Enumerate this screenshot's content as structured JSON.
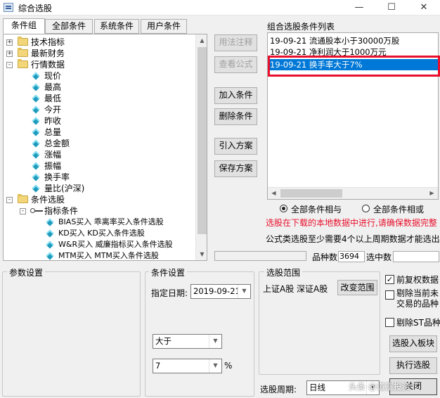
{
  "window": {
    "title": "综合选股",
    "minimize": "—",
    "maximize": "☐",
    "close": "✕"
  },
  "tabs": [
    {
      "label": "条件组",
      "active": true
    },
    {
      "label": "全部条件",
      "active": false
    },
    {
      "label": "系统条件",
      "active": false
    },
    {
      "label": "用户条件",
      "active": false
    }
  ],
  "tree": [
    {
      "label": "技术指标",
      "level": 0,
      "type": "folder",
      "expander": "+"
    },
    {
      "label": "最新财务",
      "level": 0,
      "type": "folder",
      "expander": "+"
    },
    {
      "label": "行情数据",
      "level": 0,
      "type": "folder",
      "expander": "-"
    },
    {
      "label": "现价",
      "level": 1,
      "type": "item"
    },
    {
      "label": "最高",
      "level": 1,
      "type": "item"
    },
    {
      "label": "最低",
      "level": 1,
      "type": "item"
    },
    {
      "label": "今开",
      "level": 1,
      "type": "item"
    },
    {
      "label": "昨收",
      "level": 1,
      "type": "item"
    },
    {
      "label": "总量",
      "level": 1,
      "type": "item"
    },
    {
      "label": "总金额",
      "level": 1,
      "type": "item"
    },
    {
      "label": "涨幅",
      "level": 1,
      "type": "item"
    },
    {
      "label": "振幅",
      "level": 1,
      "type": "item"
    },
    {
      "label": "换手率",
      "level": 1,
      "type": "item"
    },
    {
      "label": "量比(沪深)",
      "level": 1,
      "type": "item"
    },
    {
      "label": "条件选股",
      "level": 0,
      "type": "folder",
      "expander": "-"
    },
    {
      "label": "指标条件",
      "level": 1,
      "type": "key",
      "expander": "-"
    },
    {
      "label": "BIAS买入  乖离率买入条件选股",
      "level": 2,
      "type": "item"
    },
    {
      "label": "KD买入  KD买入条件选股",
      "level": 2,
      "type": "item"
    },
    {
      "label": "W&R买入  威廉指标买入条件选股",
      "level": 2,
      "type": "item"
    },
    {
      "label": "MTM买入  MTM买入条件选股",
      "level": 2,
      "type": "item"
    }
  ],
  "middle_buttons": {
    "note": "用法注释",
    "formula": "查看公式",
    "add": "加入条件",
    "delete": "删除条件",
    "import": "引入方案",
    "save": "保存方案"
  },
  "conditions": {
    "title": "组合选股条件列表",
    "items": [
      {
        "text": "19-09-21  流通股本小于30000万股",
        "selected": false
      },
      {
        "text": "19-09-21  净利润大于1000万元",
        "selected": false
      },
      {
        "text": "19-09-21  换手率大于7%",
        "selected": true
      }
    ]
  },
  "logic": {
    "and_label": "全部条件相与",
    "or_label": "全部条件相或",
    "selected": "and"
  },
  "notices": {
    "warning": "选股在下载的本地数据中进行,请确保数据完整",
    "info": "公式类选股至少需要4个以上周期数据才能选出"
  },
  "stats": {
    "count_label": "品种数",
    "count_value": "3694",
    "selected_label": "选中数",
    "selected_value": ""
  },
  "params": {
    "title": "参数设置"
  },
  "condition_settings": {
    "title": "条件设置",
    "date_label": "指定日期:",
    "date_value": "2019-09-21",
    "operator": "大于",
    "value": "7",
    "unit": "%"
  },
  "range": {
    "title": "选股范围",
    "markets": "上证A股  深证A股",
    "change_button": "改变范围"
  },
  "options": {
    "prior_rights": {
      "label": "前复权数据",
      "checked": true
    },
    "exclude_untraded": {
      "label": "剔除当前未交易的品种",
      "checked": false
    },
    "exclude_st": {
      "label": "剔除ST品种",
      "checked": false
    }
  },
  "actions": {
    "add_to_board": "选股入板块",
    "run": "执行选股",
    "close": "关闭"
  },
  "period": {
    "label": "选股周期:",
    "value": "日线"
  },
  "watermark": "头条 @道富投资"
}
